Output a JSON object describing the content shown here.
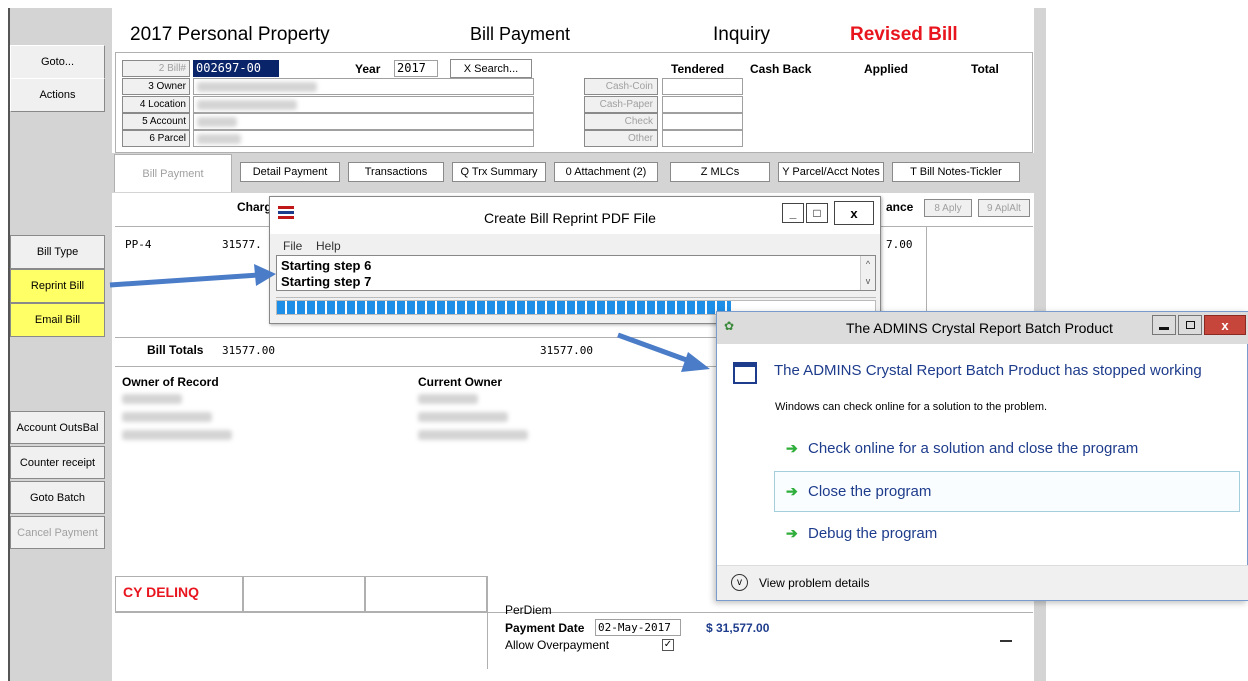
{
  "header": {
    "title": "2017 Personal Property",
    "bill_payment": "Bill Payment",
    "inquiry": "Inquiry",
    "revised": "Revised Bill"
  },
  "left_sidebar": {
    "goto": "Goto...",
    "actions": "Actions",
    "bill_type": "Bill Type",
    "reprint_bill": "Reprint Bill",
    "email_bill": "Email Bill",
    "account_outs_bal": "Account OutsBal",
    "counter_receipt": "Counter receipt",
    "goto_batch": "Goto Batch",
    "cancel_payment": "Cancel Payment"
  },
  "bill_form": {
    "bill_label": "2 Bill#",
    "bill_value": "002697-00",
    "owner_label": "3 Owner",
    "location_label": "4 Location",
    "account_label": "5 Account",
    "parcel_label": "6 Parcel",
    "year_label": "Year",
    "year_value": "2017",
    "search_label": "X Search..."
  },
  "payment_types": {
    "cash_coin": "Cash-Coin",
    "cash_paper": "Cash-Paper",
    "check": "Check",
    "other": "Other"
  },
  "columns": {
    "tendered": "Tendered",
    "cash_back": "Cash Back",
    "applied": "Applied",
    "total": "Total"
  },
  "tabs": {
    "bill_payment": "Bill Payment",
    "detail_payment": "Detail Payment",
    "transactions": "Transactions",
    "trx_summary": "Q Trx Summary",
    "attachment": "0 Attachment (2)",
    "mlcs": "Z MLCs",
    "parcel_notes": "Y Parcel/Acct Notes",
    "bill_notes": "T Bill Notes-Tickler"
  },
  "grid": {
    "charge_header": "Charg",
    "balance_header": "ance",
    "aply_btn": "8 Aply",
    "aplalt_btn": "9 AplAlt",
    "row_code": "PP-4",
    "row_charge": "31577.",
    "row_balance": "7.00",
    "bill_totals_label": "Bill Totals",
    "bill_totals_charge": "31577.00",
    "bill_totals_net": "31577.00"
  },
  "owners": {
    "owner_of_record": "Owner of Record",
    "current_owner": "Current Owner"
  },
  "bottom": {
    "cy_delinq": "CY DELINQ",
    "per_diem": "PerDiem",
    "payment_date_label": "Payment Date",
    "payment_date_value": "02-May-2017",
    "allow_overpayment": "Allow Overpayment",
    "amount_due_value": "$ 31,577.00"
  },
  "progress_dialog": {
    "title": "Create Bill Reprint PDF File",
    "menu_file": "File",
    "menu_help": "Help",
    "line1": "Starting step 6",
    "line2": "Starting step 7",
    "minimize": "_",
    "maximize": "□",
    "close": "x"
  },
  "crash_dialog": {
    "title": "The ADMINS Crystal Report Batch Product",
    "heading": "The ADMINS Crystal Report Batch Product has stopped working",
    "subtext": "Windows can check online for a solution to the problem.",
    "option1": "Check online for a solution and close the program",
    "option2": "Close the program",
    "option3": "Debug the program",
    "details": "View problem details",
    "close": "x"
  },
  "colors": {
    "revised": "#e8141e",
    "selection": "#0a246a",
    "yellow_btn": "#ffff66",
    "win_blue": "#1e3c8c",
    "arrow_blue": "#4a7cc8",
    "progress_blue": "#1e8ee6"
  }
}
